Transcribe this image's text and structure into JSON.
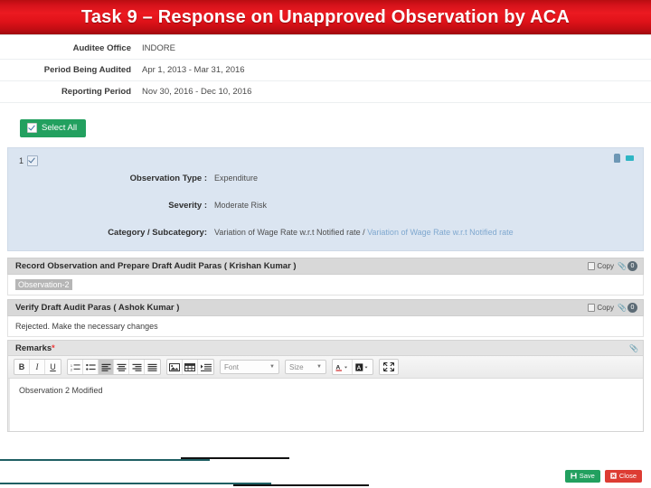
{
  "banner": {
    "title": "Task 9 – Response on Unapproved Observation by ACA",
    "color": "#e01219"
  },
  "info": {
    "rows": [
      {
        "label": "Auditee Office",
        "value": "INDORE"
      },
      {
        "label": "Period Being Audited",
        "value": "Apr 1, 2013 - Mar 31, 2016"
      },
      {
        "label": "Reporting Period",
        "value": "Nov 30, 2016 - Dec 10, 2016"
      }
    ]
  },
  "toolbar_top": {
    "select_all_label": "Select All",
    "select_all_color": "#22a05f"
  },
  "observation": {
    "index": "1",
    "rows": [
      {
        "label": "Observation Type :",
        "value": "Expenditure"
      },
      {
        "label": "Severity :",
        "value": "Moderate Risk"
      },
      {
        "label": "Category / Subcategory:",
        "value": "Variation of Wage Rate w.r.t Notified rate",
        "value2": "Variation of Wage Rate w.r.t Notified rate",
        "separator": " / "
      }
    ],
    "panel_color": "#dbe5f1"
  },
  "sections": [
    {
      "title": "Record Observation and Prepare Draft Audit Paras ( Krishan Kumar )",
      "copy_label": "Copy",
      "badge": "0",
      "body_text": "Observation-2",
      "body_highlighted": true
    },
    {
      "title": "Verify Draft Audit Paras ( Ashok Kumar )",
      "copy_label": "Copy",
      "badge": "0",
      "body_text": "Rejected. Make the necessary changes",
      "body_highlighted": false
    }
  ],
  "remarks": {
    "label": "Remarks",
    "required_mark": "*",
    "content": "Observation 2 Modified",
    "editor_toolbar": {
      "format_group": [
        {
          "name": "bold",
          "glyph": "B"
        },
        {
          "name": "italic",
          "glyph": "I"
        },
        {
          "name": "underline",
          "glyph": "U"
        }
      ],
      "list_align_group": [
        {
          "name": "numbered-list",
          "glyph": "list-ol"
        },
        {
          "name": "bullet-list",
          "glyph": "list-ul"
        },
        {
          "name": "align-left",
          "glyph": "align-left",
          "active": true
        },
        {
          "name": "align-center",
          "glyph": "align-center",
          "active": false
        },
        {
          "name": "align-right",
          "glyph": "align-right",
          "active": false
        },
        {
          "name": "align-justify",
          "glyph": "align-justify",
          "active": false
        }
      ],
      "insert_group": [
        {
          "name": "insert-image",
          "glyph": "image"
        },
        {
          "name": "insert-table",
          "glyph": "table"
        },
        {
          "name": "indent",
          "glyph": "indent"
        }
      ],
      "font_dropdown": "Font",
      "size_dropdown": "Size",
      "color_group": [
        {
          "name": "text-color",
          "glyph": "A"
        },
        {
          "name": "background-color",
          "glyph": "A-bg"
        }
      ],
      "fullscreen": "expand"
    }
  },
  "actions": {
    "save_label": "Save",
    "save_color": "#22a05f",
    "close_label": "Close",
    "close_color": "#dd3c33"
  }
}
